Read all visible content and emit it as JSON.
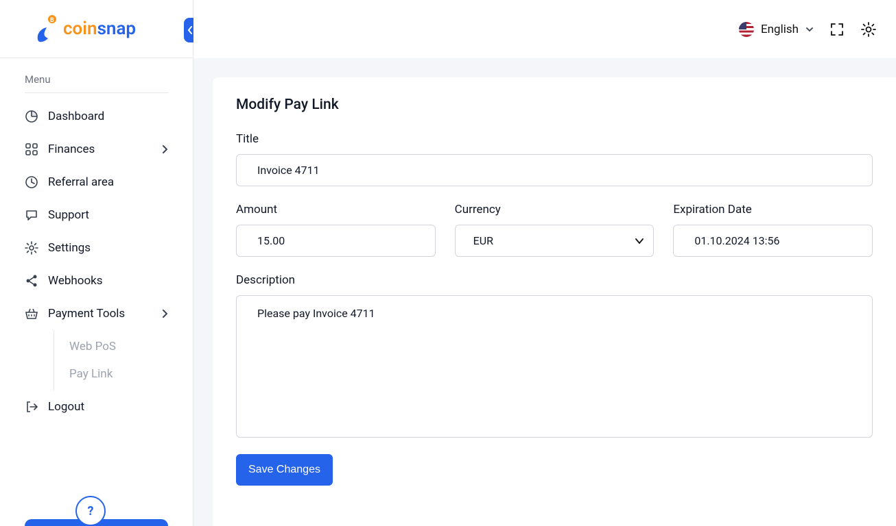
{
  "brand": {
    "part1": "coin",
    "part2": "snap"
  },
  "sidebar": {
    "menu_label": "Menu",
    "items": {
      "dashboard": "Dashboard",
      "finances": "Finances",
      "referral": "Referral area",
      "support": "Support",
      "settings": "Settings",
      "webhooks": "Webhooks",
      "payment_tools": "Payment Tools",
      "logout": "Logout"
    },
    "submenu": {
      "web_pos": "Web PoS",
      "pay_link": "Pay Link"
    }
  },
  "header": {
    "language": "English"
  },
  "page": {
    "title": "Modify Pay Link",
    "labels": {
      "title": "Title",
      "amount": "Amount",
      "currency": "Currency",
      "expiration": "Expiration Date",
      "description": "Description"
    },
    "values": {
      "title": "Invoice 4711",
      "amount": "15.00",
      "currency": "EUR",
      "expiration": "01.10.2024 13:56",
      "description": "Please pay Invoice 4711"
    },
    "save": "Save Changes"
  }
}
